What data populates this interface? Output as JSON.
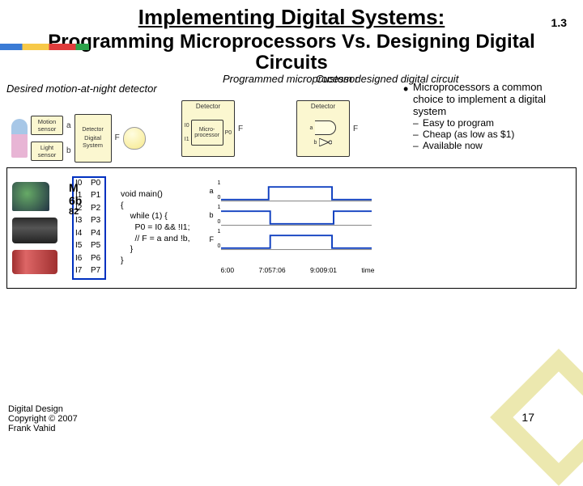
{
  "page_number_top": "1.3",
  "title_line1": "Implementing Digital Systems:",
  "title_line2": "Programming Microprocessors Vs. Designing Digital Circuits",
  "desired_label": "Desired motion-at-night detector",
  "programmed_label": "Programmed microprocessor",
  "custom_label": "Custom designed digital circuit",
  "diagram": {
    "motion_sensor": "Motion sensor",
    "light_sensor": "Light sensor",
    "digital_system": "Digital System",
    "lamp": "Lamp",
    "detector": "Detector",
    "microprocessor": "Micro-processor",
    "sig_a": "a",
    "sig_b": "b",
    "sig_f": "F",
    "io": {
      "i0": "I0",
      "i1": "I1",
      "p0": "P0"
    }
  },
  "bullets": {
    "b1": "Microprocessors a common choice to implement a digital system",
    "b2a": "Easy to program",
    "b2b": "Cheap (as low as $1)",
    "b2c": "Available now"
  },
  "pins": {
    "left": [
      "I0",
      "I1",
      "I2",
      "I3",
      "I4",
      "I5",
      "I6",
      "I7"
    ],
    "right": [
      "P0",
      "P1",
      "P2",
      "P3",
      "P4",
      "P5",
      "P6",
      "P7"
    ]
  },
  "pin_overlay": {
    "l1": "M",
    "l2": "6b",
    "l3": "82"
  },
  "code": "void main()\n{\n    while (1) {\n      P0 = I0 && !I1;\n      // F = a and !b,\n    }\n}",
  "timing": {
    "signals": [
      "a",
      "b",
      "F"
    ],
    "levels": [
      "1",
      "0"
    ],
    "ticks": [
      "6:00",
      "7:057:06",
      "9:009:01",
      "time"
    ]
  },
  "chart_data": {
    "type": "line",
    "title": "",
    "xlabel": "time",
    "ylabel": "",
    "series": [
      {
        "name": "a",
        "x": [
          6.0,
          7.05,
          7.05,
          9.0,
          9.0,
          10.0
        ],
        "y": [
          0,
          0,
          1,
          1,
          0,
          0
        ]
      },
      {
        "name": "b",
        "x": [
          6.0,
          7.06,
          7.06,
          9.01,
          9.01,
          10.0
        ],
        "y": [
          1,
          1,
          0,
          0,
          1,
          1
        ]
      },
      {
        "name": "F",
        "x": [
          6.0,
          7.06,
          7.06,
          9.0,
          9.0,
          10.0
        ],
        "y": [
          0,
          0,
          1,
          1,
          0,
          0
        ]
      }
    ],
    "ylim": [
      0,
      1
    ]
  },
  "footer": {
    "l1": "Digital Design",
    "l2": "Copyright © 2007",
    "l3": "Frank Vahid"
  },
  "slide_number": "17"
}
